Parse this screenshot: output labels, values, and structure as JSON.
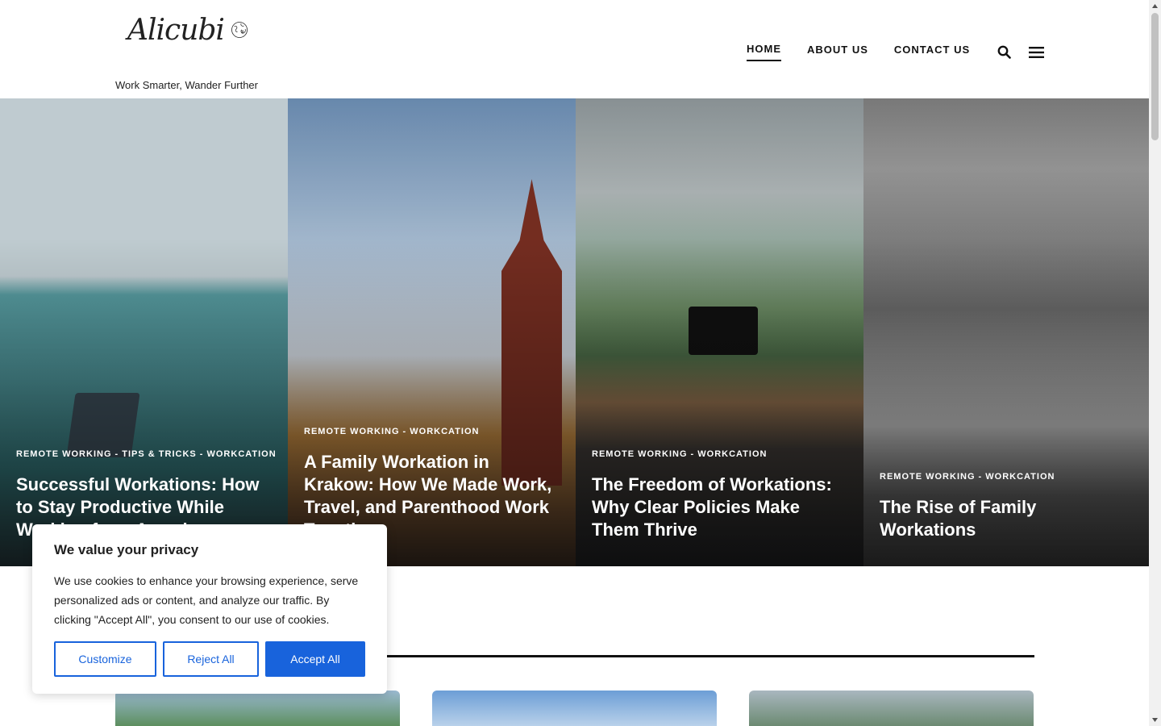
{
  "header": {
    "logo_text": "Alicubi",
    "tagline": "Work Smarter, Wander Further"
  },
  "nav": {
    "items": [
      {
        "label": "HOME",
        "active": true
      },
      {
        "label": "ABOUT US",
        "active": false
      },
      {
        "label": "CONTACT US",
        "active": false
      }
    ],
    "search_icon": "search-icon",
    "menu_icon": "hamburger-menu-icon"
  },
  "hero": {
    "cards": [
      {
        "categories": "REMOTE WORKING - TIPS & TRICKS - WORKCATION",
        "title": "Successful Workations: How to Stay Productive While Working from Anywhere"
      },
      {
        "categories": "REMOTE WORKING - WORKCATION",
        "title": "A Family Workation in Krakow: How We Made Work, Travel, and Parenthood Work Together"
      },
      {
        "categories": "REMOTE WORKING - WORKCATION",
        "title": "The Freedom of Workations: Why Clear Policies Make Them Thrive"
      },
      {
        "categories": "REMOTE WORKING - WORKCATION",
        "title": "The Rise of Family Workations"
      }
    ]
  },
  "cookie": {
    "title": "We value your privacy",
    "text": "We use cookies to enhance your browsing experience, serve personalized ads or content, and analyze our traffic. By clicking \"Accept All\", you consent to our use of cookies.",
    "customize": "Customize",
    "reject": "Reject All",
    "accept": "Accept All",
    "accent_color": "#1863dc"
  }
}
